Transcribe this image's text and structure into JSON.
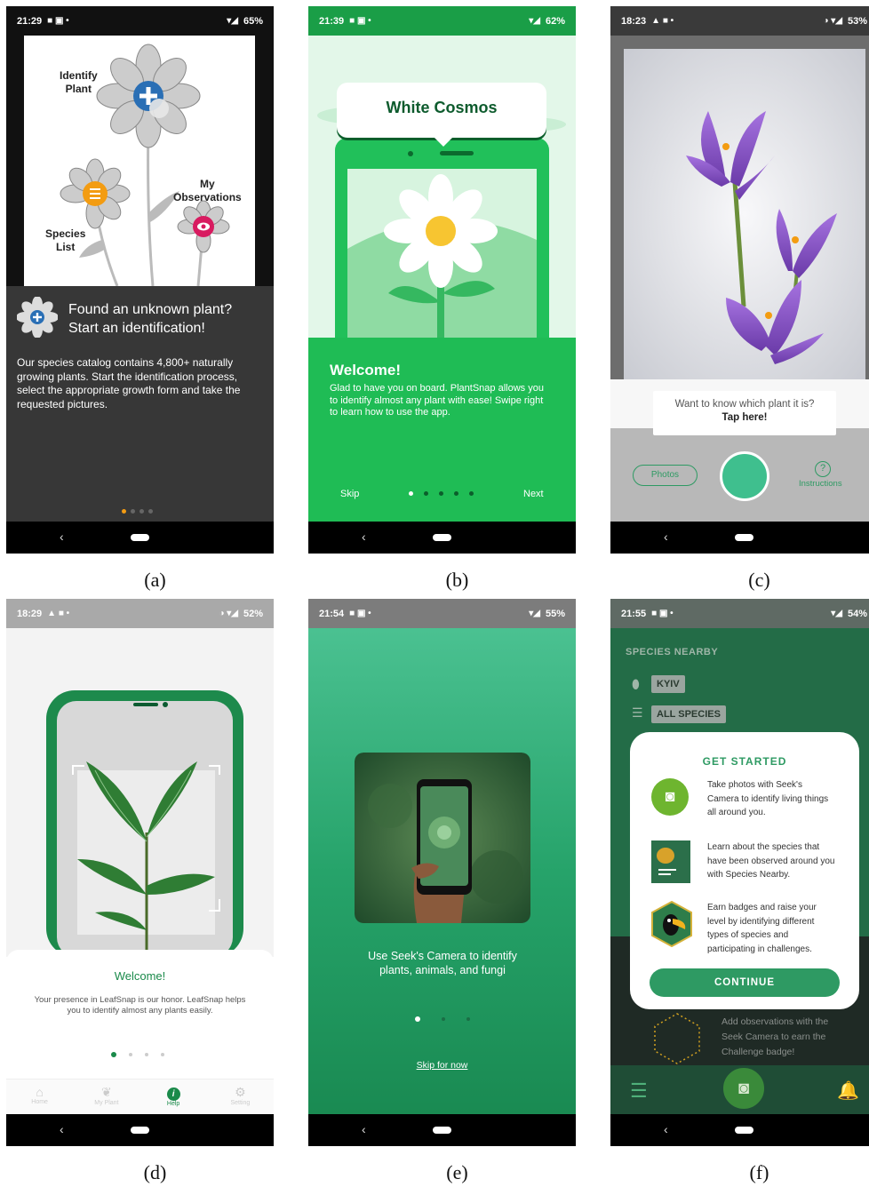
{
  "captions": [
    "(a)",
    "(b)",
    "(c)",
    "(d)",
    "(e)",
    "(f)"
  ],
  "a": {
    "status": {
      "time": "21:29",
      "battery": "65%"
    },
    "labels": {
      "identify": "Identify\nPlant",
      "observations": "My\nObservations",
      "species": "Species\nList"
    },
    "title": "Found an unknown plant?\nStart an identification!",
    "body": "Our species catalog contains 4,800+ naturally growing plants. Start the identification process, select the appropriate growth form and take the requested pictures.",
    "page_index": 1,
    "page_count": 4
  },
  "b": {
    "status": {
      "time": "21:39",
      "battery": "62%"
    },
    "plant_name": "White Cosmos",
    "welcome_title": "Welcome!",
    "welcome_body": "Glad to have you on board. PlantSnap allows you to identify almost any plant with ease! Swipe right to learn how to use the app.",
    "skip": "Skip",
    "next": "Next",
    "page_index": 1,
    "page_count": 5
  },
  "c": {
    "status": {
      "time": "18:23",
      "battery": "53%"
    },
    "tooltip_line1": "Want to know which plant it is?",
    "tooltip_line2": "Tap here!",
    "photos": "Photos",
    "instructions": "Instructions"
  },
  "d": {
    "status": {
      "time": "18:29",
      "battery": "52%"
    },
    "welcome_title": "Welcome!",
    "welcome_body": "Your presence in LeafSnap is our honor. LeafSnap helps you to identify almost any plants easily.",
    "page_index": 1,
    "page_count": 4,
    "tabs": [
      "Home",
      "My Plant",
      "Help",
      "Setting"
    ],
    "active_tab": 2
  },
  "e": {
    "status": {
      "time": "21:54",
      "battery": "55%"
    },
    "caption": "Use Seek's Camera to identify plants, animals, and fungi",
    "skip": "Skip for now",
    "page_index": 1,
    "page_count": 3
  },
  "f": {
    "status": {
      "time": "21:55",
      "battery": "54%"
    },
    "species_nearby": "SPECIES NEARBY",
    "location": "KYIV",
    "filter": "ALL SPECIES",
    "card_title": "GET STARTED",
    "items": [
      "Take photos with Seek's Camera to identify living things all around you.",
      "Learn about the species that have been observed around you with Species Nearby.",
      "Earn badges and raise your level by identifying different types of species and participating in challenges."
    ],
    "continue": "CONTINUE",
    "challenge_text": "Add observations with the Seek Camera to earn the Challenge badge!"
  },
  "colors": {
    "plantsnap_green": "#1fbc55",
    "seek_green": "#2e9a63",
    "leafsnap_green": "#1a8a4a",
    "dark_panel": "#373737",
    "accent_orange": "#f39c12"
  }
}
